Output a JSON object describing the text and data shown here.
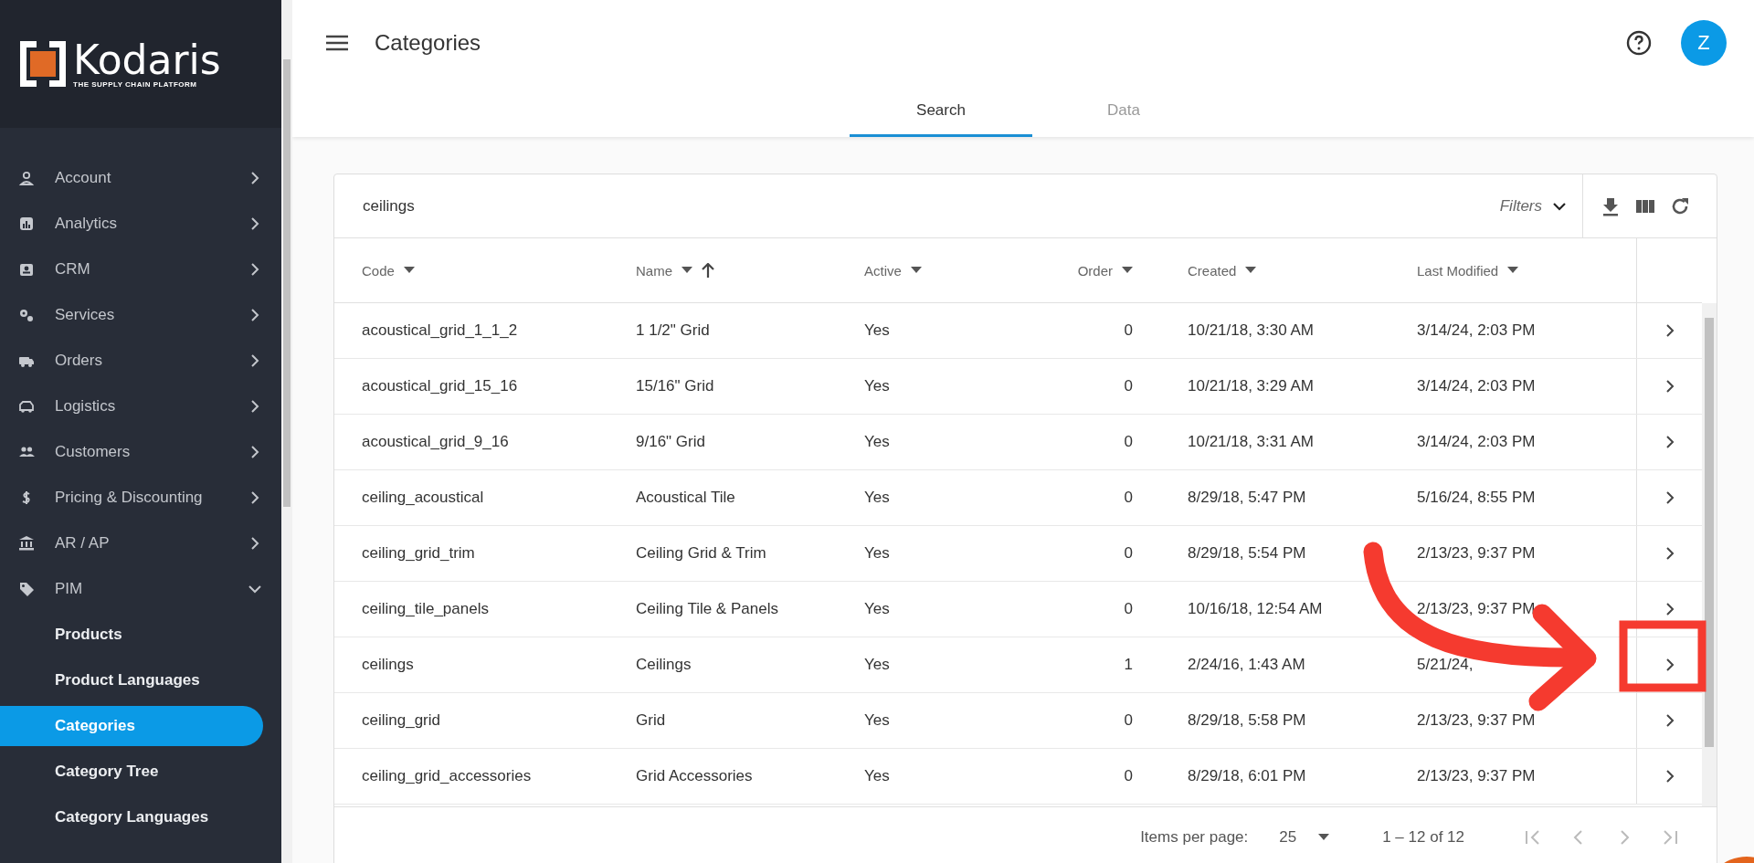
{
  "brand": {
    "name": "Kodaris",
    "tagline": "THE SUPPLY CHAIN PLATFORM"
  },
  "sidebar": {
    "items": [
      {
        "label": "Account",
        "expanded": false
      },
      {
        "label": "Analytics",
        "expanded": false
      },
      {
        "label": "CRM",
        "expanded": false
      },
      {
        "label": "Services",
        "expanded": false
      },
      {
        "label": "Orders",
        "expanded": false
      },
      {
        "label": "Logistics",
        "expanded": false
      },
      {
        "label": "Customers",
        "expanded": false
      },
      {
        "label": "Pricing & Discounting",
        "expanded": false
      },
      {
        "label": "AR / AP",
        "expanded": false
      },
      {
        "label": "PIM",
        "expanded": true,
        "children": [
          {
            "label": "Products",
            "selected": false
          },
          {
            "label": "Product Languages",
            "selected": false
          },
          {
            "label": "Categories",
            "selected": true
          },
          {
            "label": "Category Tree",
            "selected": false
          },
          {
            "label": "Category Languages",
            "selected": false
          }
        ]
      }
    ]
  },
  "header": {
    "title": "Categories",
    "avatar": "Z"
  },
  "tabs": [
    {
      "label": "Search",
      "selected": true
    },
    {
      "label": "Data",
      "selected": false
    }
  ],
  "search": {
    "value": "ceilings",
    "filters_label": "Filters"
  },
  "table": {
    "columns": [
      {
        "label": "Code",
        "sorted": false
      },
      {
        "label": "Name",
        "sorted": true
      },
      {
        "label": "Active",
        "sorted": false
      },
      {
        "label": "Order",
        "sorted": false
      },
      {
        "label": "Created",
        "sorted": false
      },
      {
        "label": "Last Modified",
        "sorted": false
      }
    ],
    "rows": [
      [
        "acoustical_grid_1_1_2",
        "1 1/2\" Grid",
        "Yes",
        "0",
        "10/21/18, 3:30 AM",
        "3/14/24, 2:03 PM"
      ],
      [
        "acoustical_grid_15_16",
        "15/16\" Grid",
        "Yes",
        "0",
        "10/21/18, 3:29 AM",
        "3/14/24, 2:03 PM"
      ],
      [
        "acoustical_grid_9_16",
        "9/16\" Grid",
        "Yes",
        "0",
        "10/21/18, 3:31 AM",
        "3/14/24, 2:03 PM"
      ],
      [
        "ceiling_acoustical",
        "Acoustical Tile",
        "Yes",
        "0",
        "8/29/18, 5:47 PM",
        "5/16/24, 8:55 PM"
      ],
      [
        "ceiling_grid_trim",
        "Ceiling Grid & Trim",
        "Yes",
        "0",
        "8/29/18, 5:54 PM",
        "2/13/23, 9:37 PM"
      ],
      [
        "ceiling_tile_panels",
        "Ceiling Tile & Panels",
        "Yes",
        "0",
        "10/16/18, 12:54 AM",
        "2/13/23, 9:37 PM"
      ],
      [
        "ceilings",
        "Ceilings",
        "Yes",
        "1",
        "2/24/16, 1:43 AM",
        "5/21/24,"
      ],
      [
        "ceiling_grid",
        "Grid",
        "Yes",
        "0",
        "8/29/18, 5:58 PM",
        "2/13/23, 9:37 PM"
      ],
      [
        "ceiling_grid_accessories",
        "Grid Accessories",
        "Yes",
        "0",
        "8/29/18, 6:01 PM",
        "2/13/23, 9:37 PM"
      ]
    ]
  },
  "paginator": {
    "items_per_page_label": "Items per page:",
    "page_size": "25",
    "range": "1 – 12 of 12",
    "first_disabled": true,
    "previous_disabled": true,
    "next_disabled": true,
    "last_disabled": true
  }
}
